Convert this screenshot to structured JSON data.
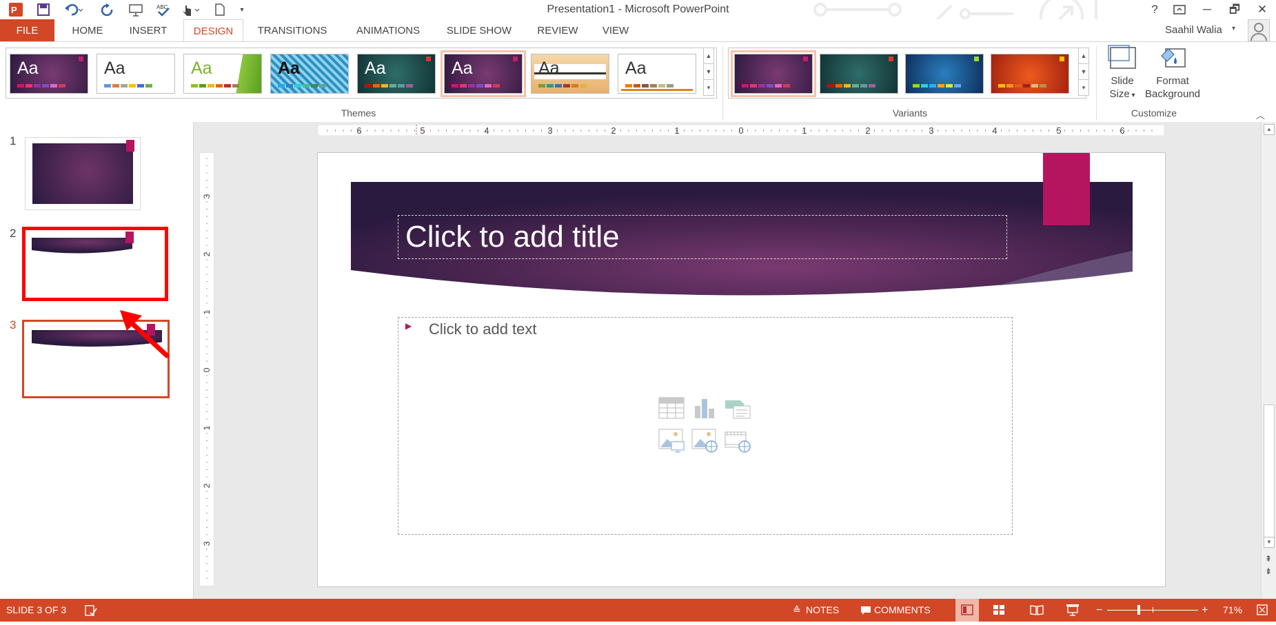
{
  "window": {
    "title": "Presentation1 - Microsoft PowerPoint",
    "help_label": "?",
    "user_name": "Saahil Walia"
  },
  "tabs": [
    "FILE",
    "HOME",
    "INSERT",
    "DESIGN",
    "TRANSITIONS",
    "ANIMATIONS",
    "SLIDE SHOW",
    "REVIEW",
    "VIEW"
  ],
  "active_tab": "DESIGN",
  "ribbon": {
    "themes_label": "Themes",
    "variants_label": "Variants",
    "customize_label": "Customize",
    "theme_sample_text": "Aa",
    "slide_size_label_1": "Slide",
    "slide_size_label_2": "Size",
    "format_bg_label_1": "Format",
    "format_bg_label_2": "Background"
  },
  "slides_pane": {
    "numbers": [
      "1",
      "2",
      "3"
    ],
    "selected": "3"
  },
  "slide": {
    "title_placeholder": "Click to add title",
    "content_placeholder": "Click to add text"
  },
  "rulers": {
    "h_labels": [
      "6",
      "5",
      "4",
      "3",
      "2",
      "1",
      "0",
      "1",
      "2",
      "3",
      "4",
      "5",
      "6"
    ],
    "v_labels": [
      "3",
      "2",
      "1",
      "0",
      "1",
      "2",
      "3"
    ]
  },
  "statusbar": {
    "slide_info": "SLIDE 3 OF 3",
    "notes": "NOTES",
    "comments": "COMMENTS",
    "zoom": "71%"
  },
  "colors": {
    "accent": "#d24726",
    "theme_purple": "#3a1f4e",
    "theme_magenta": "#b5155f",
    "annotation_red": "#ff0000"
  }
}
